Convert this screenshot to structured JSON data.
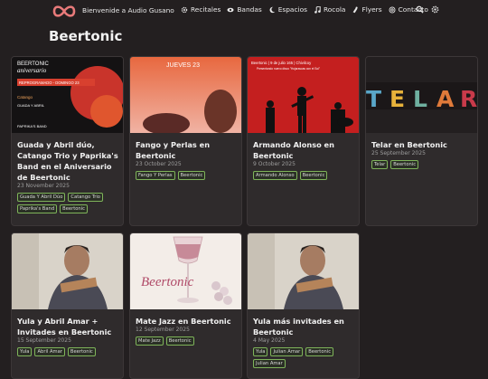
{
  "nav": {
    "brand": "Bienvenide a Audio Gusano",
    "links": [
      {
        "label": "Recitales",
        "icon": "gear-icon"
      },
      {
        "label": "Bandas",
        "icon": "eye-icon"
      },
      {
        "label": "Espacios",
        "icon": "moon-icon"
      },
      {
        "label": "Rocola",
        "icon": "music-note-icon"
      },
      {
        "label": "Flyers",
        "icon": "flyer-icon"
      },
      {
        "label": "Contacto",
        "icon": "at-icon"
      }
    ],
    "tools": [
      "search-icon",
      "settings-icon"
    ]
  },
  "page": {
    "title": "Beertonic"
  },
  "cards": [
    {
      "title": "Guada y Abril dúo, Catango Trio y Paprika's Band en el Aniversario de Beertonic",
      "date": "23 November 2025",
      "tags": [
        "Guada Y Abril Dúo",
        "Catango Trio",
        "Paprika's Band",
        "Beertonic"
      ],
      "flyer_text": [
        "BEERTONIC",
        "aniversario",
        "REPROGRAMADO - DOMINGO 23",
        "Catango",
        "GUADA Y ABRIL",
        "PAPRIKA'S BAND"
      ]
    },
    {
      "title": "Fango y Perlas en Beertonic",
      "date": "23 October 2025",
      "tags": [
        "Fango Y Perlas",
        "Beertonic"
      ],
      "flyer_text": [
        "JUEVES 23"
      ]
    },
    {
      "title": "Armando Alonso en Beertonic",
      "date": "9 October 2025",
      "tags": [
        "Armando Alonso",
        "Beertonic"
      ],
      "flyer_text": [
        "Beertonic | 9 de julio 165 | Chivilcoy",
        "Presentando nuevo disco \"Hojarascas con el Sol\""
      ]
    },
    {
      "title": "Telar en Beertonic",
      "date": "25 September 2025",
      "tags": [
        "Telar",
        "Beertonic"
      ],
      "flyer_text": [
        "TELAR"
      ]
    },
    {
      "title": "Yula y Abril Amar + Invitades en Beertonic",
      "date": "15 September 2025",
      "tags": [
        "Yula",
        "Abril Amar",
        "Beertonic"
      ],
      "flyer_text": []
    },
    {
      "title": "Mate Jazz en Beertonic",
      "date": "12 September 2025",
      "tags": [
        "Mate Jazz",
        "Beertonic"
      ],
      "flyer_text": [
        "Beertonic"
      ]
    },
    {
      "title": "Yula más invitades en Beertonic",
      "date": "4 May 2025",
      "tags": [
        "Yula",
        "Julian Amar",
        "Beertonic",
        "Julian Amar"
      ],
      "flyer_text": []
    }
  ],
  "colors": {
    "background": "#231f20",
    "card": "#2f2b2c",
    "tag_border": "#7fb45a",
    "logo": "#e87a7a"
  }
}
